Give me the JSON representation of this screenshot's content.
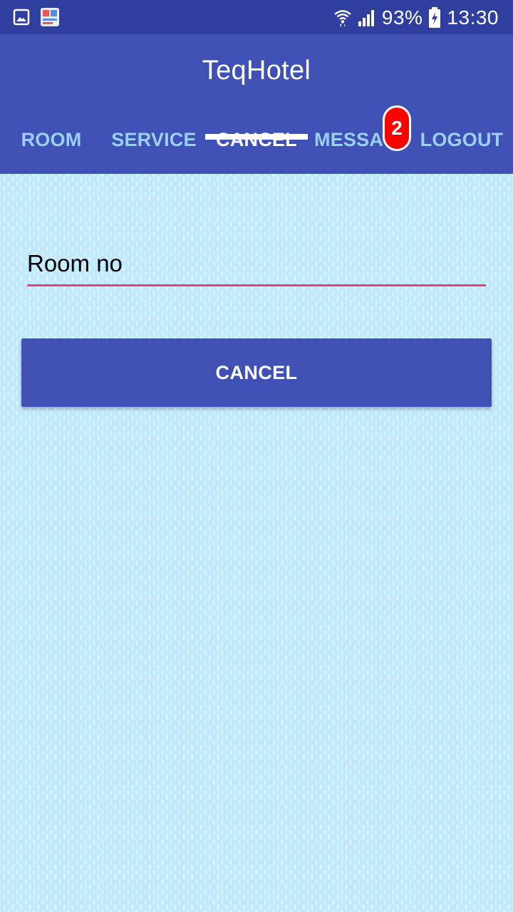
{
  "status_bar": {
    "battery": "93%",
    "time": "13:30",
    "icons": [
      "gallery-icon",
      "app-notification-icon",
      "wifi-icon",
      "signal-icon",
      "battery-charging-icon"
    ]
  },
  "app_bar": {
    "title": "TeqHotel",
    "tabs": [
      {
        "label": "ROOM"
      },
      {
        "label": "SERVICE"
      },
      {
        "label": "CANCEL"
      },
      {
        "label": "MESSAGES",
        "badge": "2"
      },
      {
        "label": "LOGOUT"
      }
    ],
    "active_tab": "CANCEL"
  },
  "form": {
    "room_placeholder": "Room no",
    "cancel_label": "CANCEL"
  },
  "colors": {
    "primary": "#3f51b5",
    "primary_dark": "#303f9f",
    "accent": "#ec407a",
    "tab_inactive": "#9bd0f5",
    "badge": "#ff0000",
    "background": "#c0eafb"
  }
}
